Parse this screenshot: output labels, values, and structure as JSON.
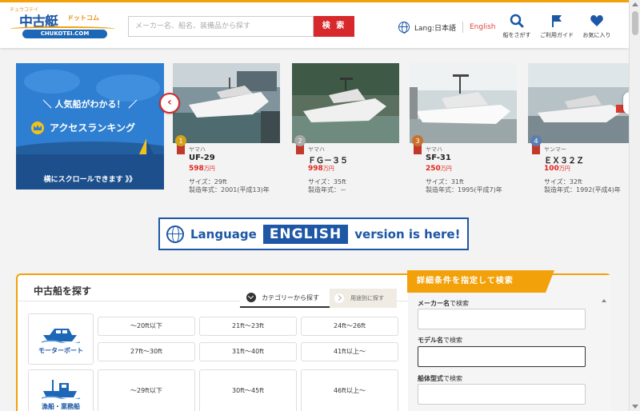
{
  "header": {
    "logo_small": "チュウコテイ",
    "logo_main": "中古艇",
    "logo_dot": "ドットコム",
    "logo_url": "CHUKOTEI.COM",
    "search_placeholder": "メーカー名、船名、装備品から探す",
    "search_button": "検 索",
    "lang_label": "Lang:日本語",
    "lang_english": "English",
    "nav": [
      {
        "label": "船をさがす",
        "icon": "search-icon"
      },
      {
        "label": "ご利用ガイド",
        "icon": "flag-icon"
      },
      {
        "label": "お気に入り",
        "icon": "heart-icon"
      }
    ]
  },
  "ranking": {
    "title": "＼ 人気船がわかる！ ／",
    "main": "アクセスランキング",
    "scroll_hint": "横にスクロールできます 》》"
  },
  "boats": [
    {
      "rank": "1",
      "maker": "ヤマハ",
      "model": "UF-29",
      "price": "598",
      "unit": "万円",
      "size": "サイズ：29ft",
      "year": "製造年式：2001(平成13)年",
      "badge_color": "#d4a21a"
    },
    {
      "rank": "2",
      "maker": "ヤマハ",
      "model": "ＦＧ－３５",
      "price": "998",
      "unit": "万円",
      "size": "サイズ：35ft",
      "year": "製造年式：－",
      "badge_color": "#a9a9a9"
    },
    {
      "rank": "3",
      "maker": "ヤマハ",
      "model": "SF-31",
      "price": "250",
      "unit": "万円",
      "size": "サイズ：31ft",
      "year": "製造年式：1995(平成7)年",
      "badge_color": "#c8722e"
    },
    {
      "rank": "4",
      "maker": "ヤンマー",
      "model": "ＥＸ３２Ｚ",
      "price": "100",
      "unit": "万円",
      "size": "サイズ：32ft",
      "year": "製造年式：1992(平成4)年",
      "badge_color": "#5a7fb5"
    }
  ],
  "english_banner": {
    "text1": "Language",
    "highlight": "ENGLISH",
    "text2": "version is here!"
  },
  "search_section": {
    "title": "中古船を探す",
    "tab_category": "カテゴリーから探す",
    "tab_usage": "用途別に探す",
    "types": [
      {
        "label": "モーターボート",
        "sizes": [
          "〜20ft以下",
          "21ft〜23ft",
          "24ft〜26ft",
          "27ft〜30ft",
          "31ft〜40ft",
          "41ft以上〜"
        ]
      },
      {
        "label": "漁船・業務船",
        "sizes": [
          "〜29ft以下",
          "30ft〜45ft",
          "46ft以上〜"
        ]
      }
    ]
  },
  "detail_search": {
    "title": "詳細条件を指定して検索",
    "fields": [
      {
        "bold": "メーカー名",
        "rest": "で検索"
      },
      {
        "bold": "モデル名",
        "rest": "で検索"
      },
      {
        "bold": "船体型式",
        "rest": "で検索"
      }
    ]
  }
}
